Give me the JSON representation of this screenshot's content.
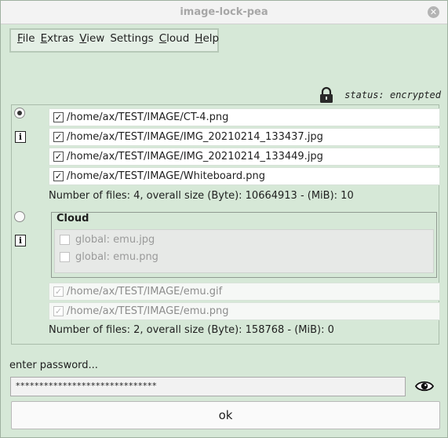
{
  "window": {
    "title": "image-lock-pea",
    "close_symbol": "✕"
  },
  "menu": {
    "items": [
      {
        "ul": "F",
        "rest": "ile"
      },
      {
        "ul": "E",
        "rest": "xtras"
      },
      {
        "ul": "V",
        "rest": "iew"
      },
      {
        "ul": "",
        "rest": "Settings"
      },
      {
        "ul": "C",
        "rest": "loud"
      },
      {
        "ul": "H",
        "rest": "elp"
      }
    ]
  },
  "status": {
    "text": "status: encrypted",
    "icon": "lock-icon"
  },
  "local_group": {
    "files": [
      {
        "path": "/home/ax/TEST/IMAGE/CT-4.png",
        "checked": "✓"
      },
      {
        "path": "/home/ax/TEST/IMAGE/IMG_20210214_133437.jpg",
        "checked": "✓"
      },
      {
        "path": "/home/ax/TEST/IMAGE/IMG_20210214_133449.jpg",
        "checked": "✓"
      },
      {
        "path": "/home/ax/TEST/IMAGE/Whiteboard.png",
        "checked": "✓"
      }
    ],
    "summary": "Number of files: 4, overall size (Byte): 10664913 - (MiB): 10"
  },
  "cloud_group": {
    "title": "Cloud",
    "cloud_items": [
      {
        "label": "global: emu.jpg"
      },
      {
        "label": "global: emu.png"
      }
    ],
    "files": [
      {
        "path": "/home/ax/TEST/IMAGE/emu.gif",
        "checked": "✓"
      },
      {
        "path": "/home/ax/TEST/IMAGE/emu.png",
        "checked": "✓"
      }
    ],
    "summary": "Number of files: 2, overall size (Byte): 158768 - (MiB): 0"
  },
  "info_symbol": "i",
  "password": {
    "label": "enter password...",
    "value": "******************************"
  },
  "ok_label": "ok"
}
